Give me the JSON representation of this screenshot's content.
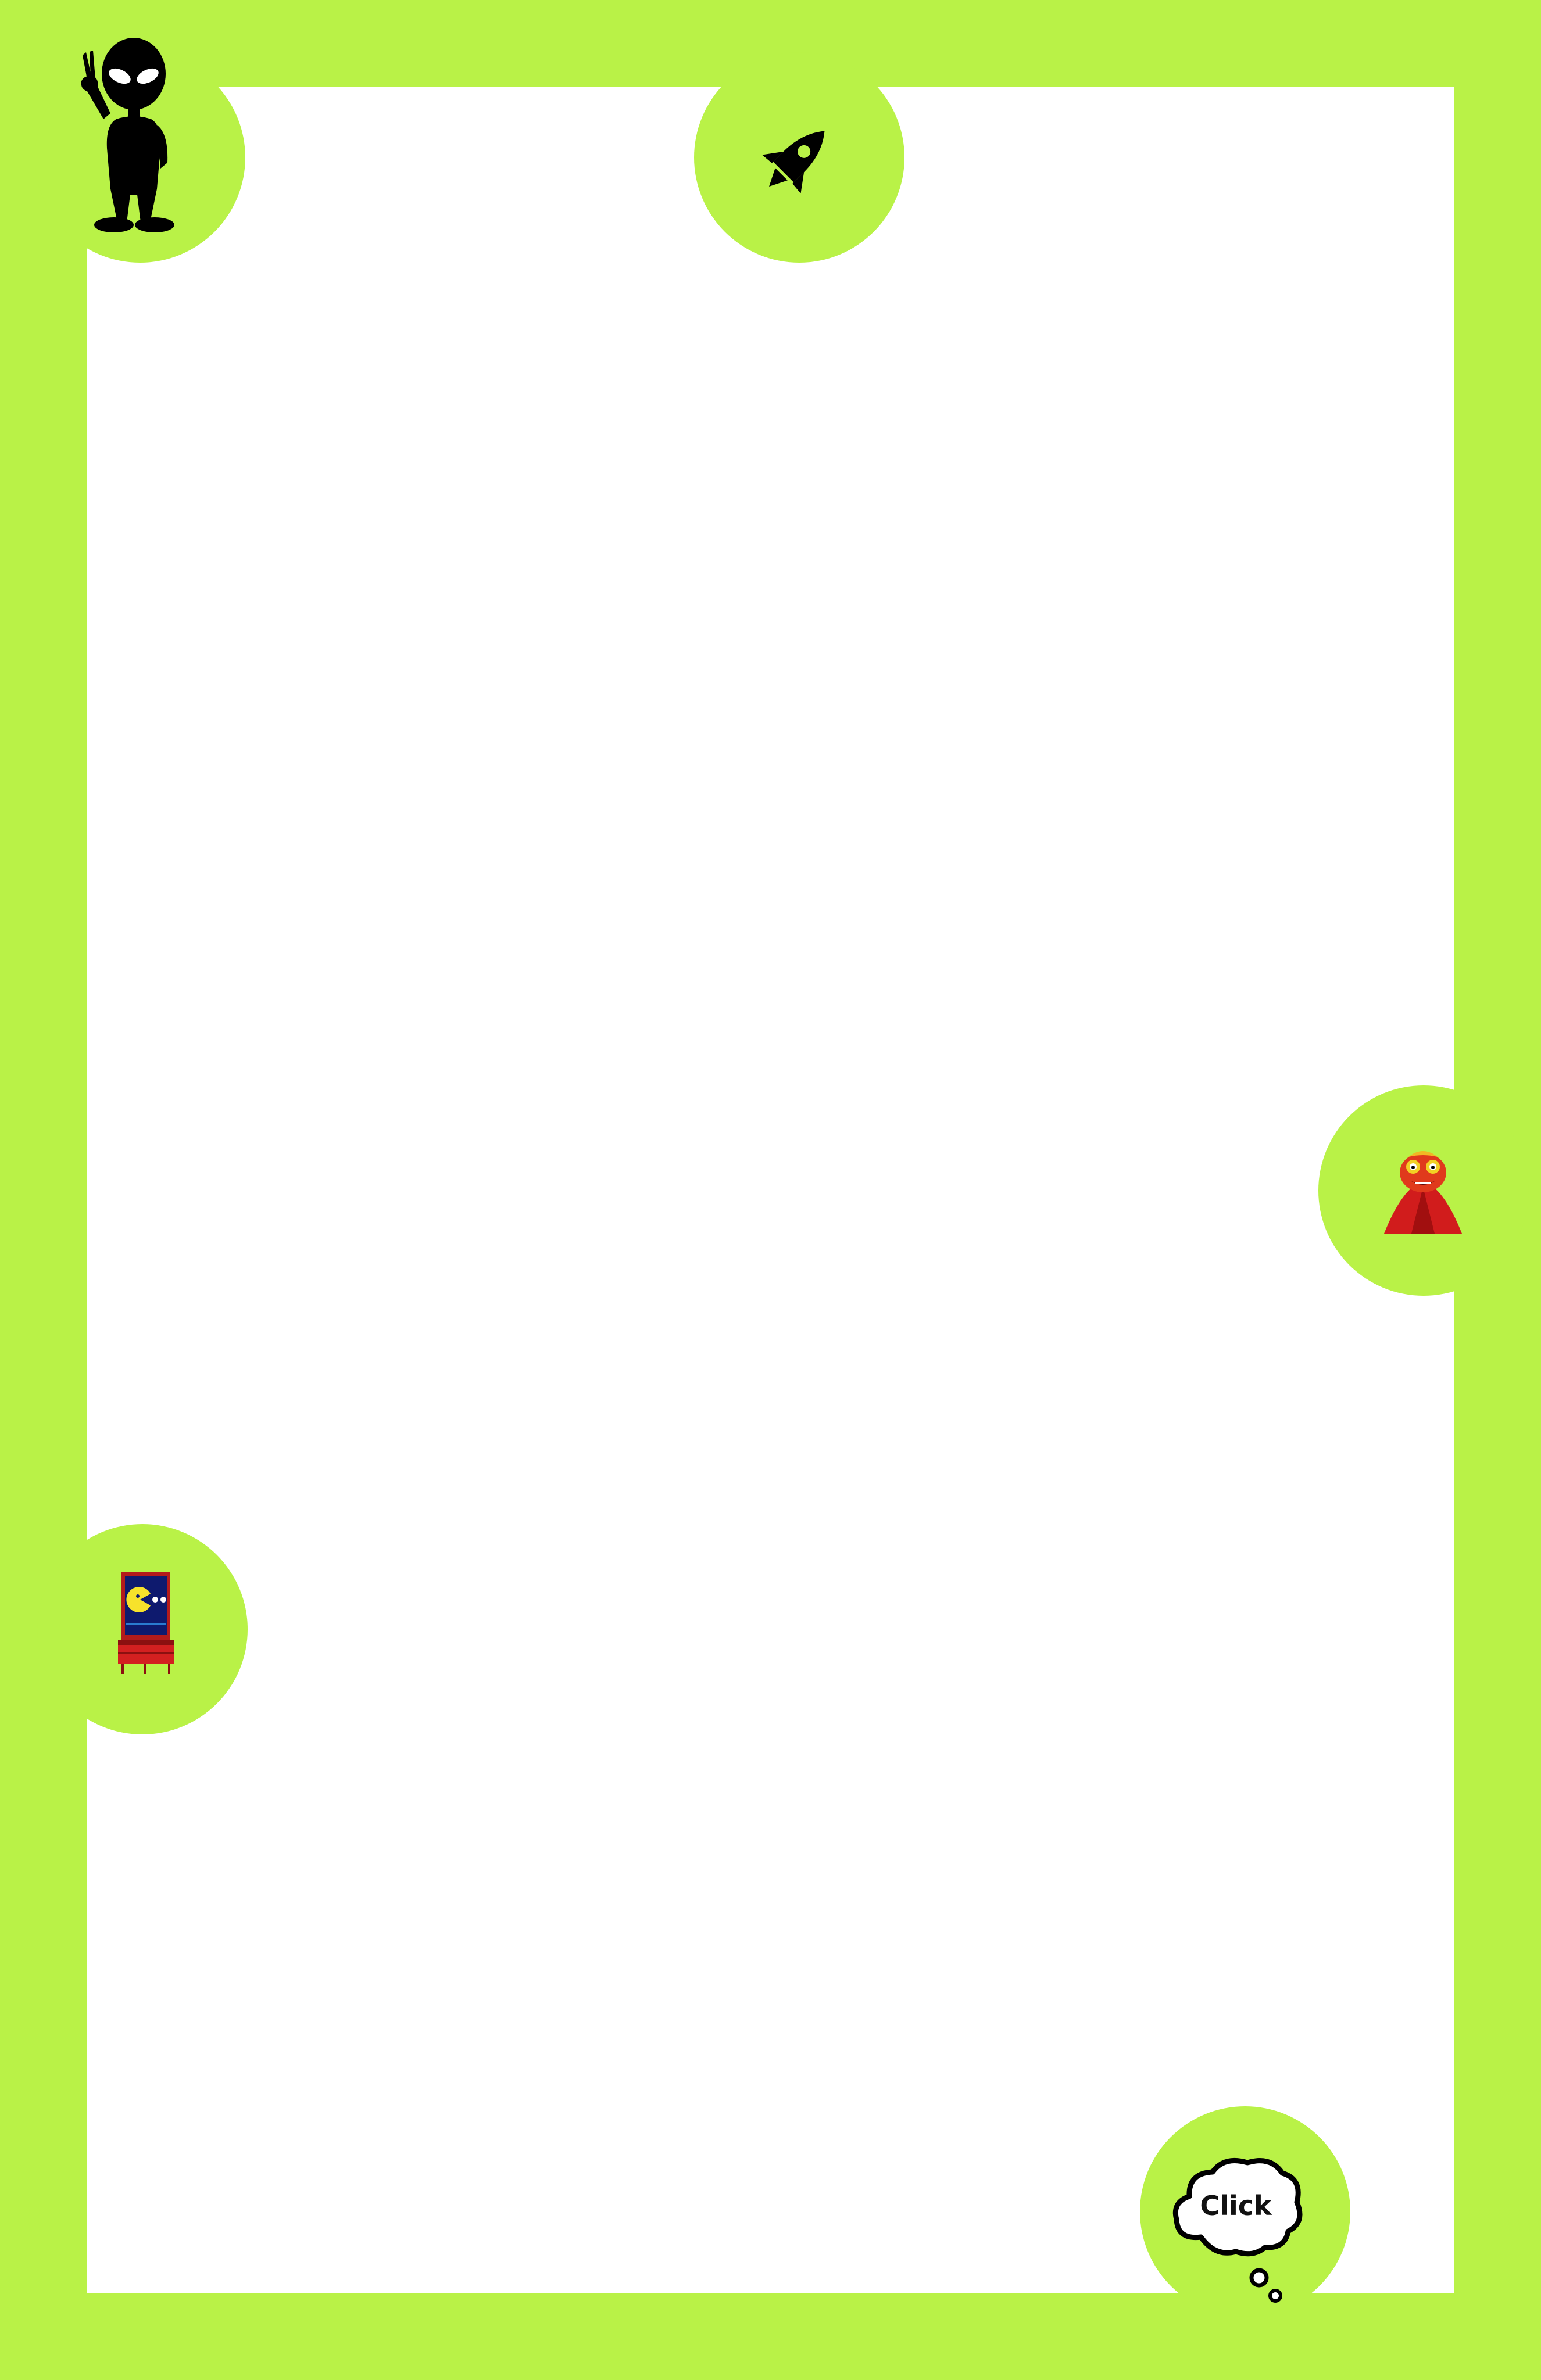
{
  "theme": {
    "border_color": "#b9f247",
    "board_color": "#ffffff",
    "icon_color": "#000000"
  },
  "tokens": [
    {
      "name": "alien",
      "icon": "alien-icon"
    },
    {
      "name": "rocket",
      "icon": "rocket-icon"
    },
    {
      "name": "red-monster",
      "icon": "red-monster-icon"
    },
    {
      "name": "arcade-cabinet",
      "icon": "arcade-cabinet-icon"
    },
    {
      "name": "click",
      "icon": "thought-bubble-icon"
    }
  ],
  "click_bubble": {
    "label": "Click"
  }
}
